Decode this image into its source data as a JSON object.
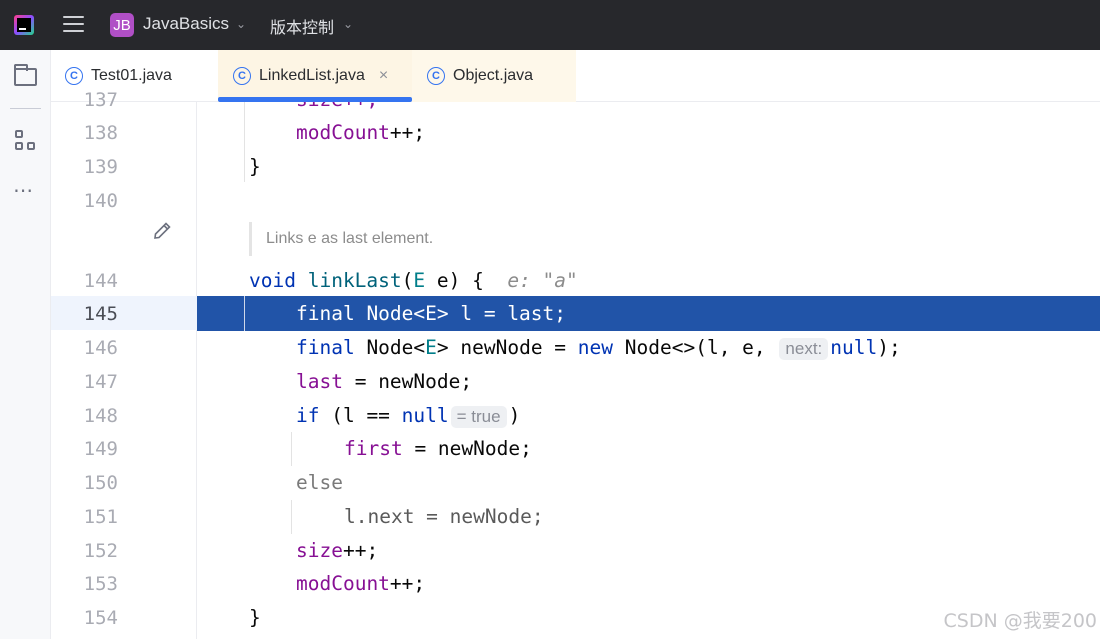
{
  "titlebar": {
    "project_badge": "JB",
    "project_name": "JavaBasics",
    "vcs_label": "版本控制",
    "icons": [
      "app-logo-icon",
      "hamburger-menu-icon",
      "chevron-down-icon"
    ]
  },
  "tabs": [
    {
      "label": "Test01.java",
      "icon": "C",
      "active": false
    },
    {
      "label": "LinkedList.java",
      "icon": "C",
      "active": true,
      "close": "×"
    },
    {
      "label": "Object.java",
      "icon": "C",
      "active": false
    }
  ],
  "gutter": {
    "lines": [
      "137",
      "138",
      "139",
      "140",
      "144",
      "145",
      "146",
      "147",
      "148",
      "149",
      "150",
      "151",
      "152",
      "153",
      "154"
    ],
    "current_line": "145"
  },
  "editor": {
    "doc_comment": "Links e as last element.",
    "method_hint": "e: \"a\"",
    "param_hint": "next:",
    "value_hint": "= true",
    "lines": {
      "l137": "size++;",
      "l138_field": "modCount",
      "l138_op": "++;",
      "l139": "}",
      "l144_kw": "void",
      "l144_fn": "linkLast",
      "l144_open": "(",
      "l144_type": "E",
      "l144_rest": " e) {",
      "l145": "final Node<E> l = last;",
      "l146_kw": "final",
      "l146_a": " Node<",
      "l146_type": "E",
      "l146_b": "> newNode = ",
      "l146_new": "new",
      "l146_c": " Node<>(l, e, ",
      "l146_null": "null",
      "l146_end": ");",
      "l147_field": "last",
      "l147_rest": " = newNode;",
      "l148_kw": "if",
      "l148_a": " (l == ",
      "l148_null": "null",
      "l148_end": ")",
      "l149_field": "first",
      "l149_rest": " = newNode;",
      "l150": "else",
      "l151": "l.next = newNode;",
      "l152_field": "size",
      "l152_rest": "++;",
      "l153_field": "modCount",
      "l153_rest": "++;",
      "l154": "}"
    }
  },
  "watermark": "CSDN @我要200",
  "colors": {
    "titlebar_bg": "#27282c",
    "selection": "#2154a8",
    "keyword": "#0033b3",
    "field": "#871094",
    "accent": "#3574f0"
  }
}
